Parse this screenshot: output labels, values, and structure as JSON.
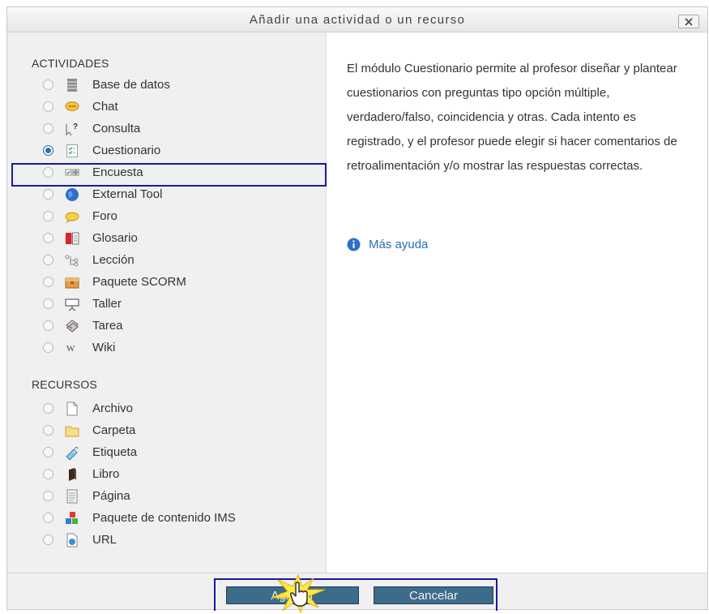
{
  "dialog": {
    "title": "Añadir una actividad o un recurso",
    "close_label": "✕"
  },
  "activities": {
    "heading": "ACTIVIDADES",
    "items": [
      {
        "label": "Base de datos",
        "icon": "database-icon",
        "selected": false
      },
      {
        "label": "Chat",
        "icon": "chat-icon",
        "selected": false
      },
      {
        "label": "Consulta",
        "icon": "choice-icon",
        "selected": false
      },
      {
        "label": "Cuestionario",
        "icon": "quiz-icon",
        "selected": true
      },
      {
        "label": "Encuesta",
        "icon": "survey-icon",
        "selected": false
      },
      {
        "label": "External Tool",
        "icon": "external-tool-icon",
        "selected": false
      },
      {
        "label": "Foro",
        "icon": "forum-icon",
        "selected": false
      },
      {
        "label": "Glosario",
        "icon": "glossary-icon",
        "selected": false
      },
      {
        "label": "Lección",
        "icon": "lesson-icon",
        "selected": false
      },
      {
        "label": "Paquete SCORM",
        "icon": "scorm-icon",
        "selected": false
      },
      {
        "label": "Taller",
        "icon": "workshop-icon",
        "selected": false
      },
      {
        "label": "Tarea",
        "icon": "assignment-icon",
        "selected": false
      },
      {
        "label": "Wiki",
        "icon": "wiki-icon",
        "selected": false
      }
    ]
  },
  "resources": {
    "heading": "RECURSOS",
    "items": [
      {
        "label": "Archivo",
        "icon": "file-icon",
        "selected": false
      },
      {
        "label": "Carpeta",
        "icon": "folder-icon",
        "selected": false
      },
      {
        "label": "Etiqueta",
        "icon": "label-icon",
        "selected": false
      },
      {
        "label": "Libro",
        "icon": "book-icon",
        "selected": false
      },
      {
        "label": "Página",
        "icon": "page-icon",
        "selected": false
      },
      {
        "label": "Paquete de contenido IMS",
        "icon": "ims-package-icon",
        "selected": false
      },
      {
        "label": "URL",
        "icon": "url-icon",
        "selected": false
      }
    ]
  },
  "description": {
    "text": "El módulo Cuestionario permite al profesor diseñar y plantear cuestionarios con preguntas tipo opción múltiple, verdadero/falso, coincidencia y otras. Cada intento es registrado, y el profesor puede elegir si hacer comentarios de retroalimentación y/o mostrar las respuestas correctas.",
    "help_label": "Más ayuda"
  },
  "footer": {
    "add_label": "Agregar",
    "cancel_label": "Cancelar"
  },
  "colors": {
    "accent": "#2f6fb0",
    "button": "#3d6b8c",
    "highlight_box": "#1a1aa0",
    "link": "#2a6db8"
  }
}
